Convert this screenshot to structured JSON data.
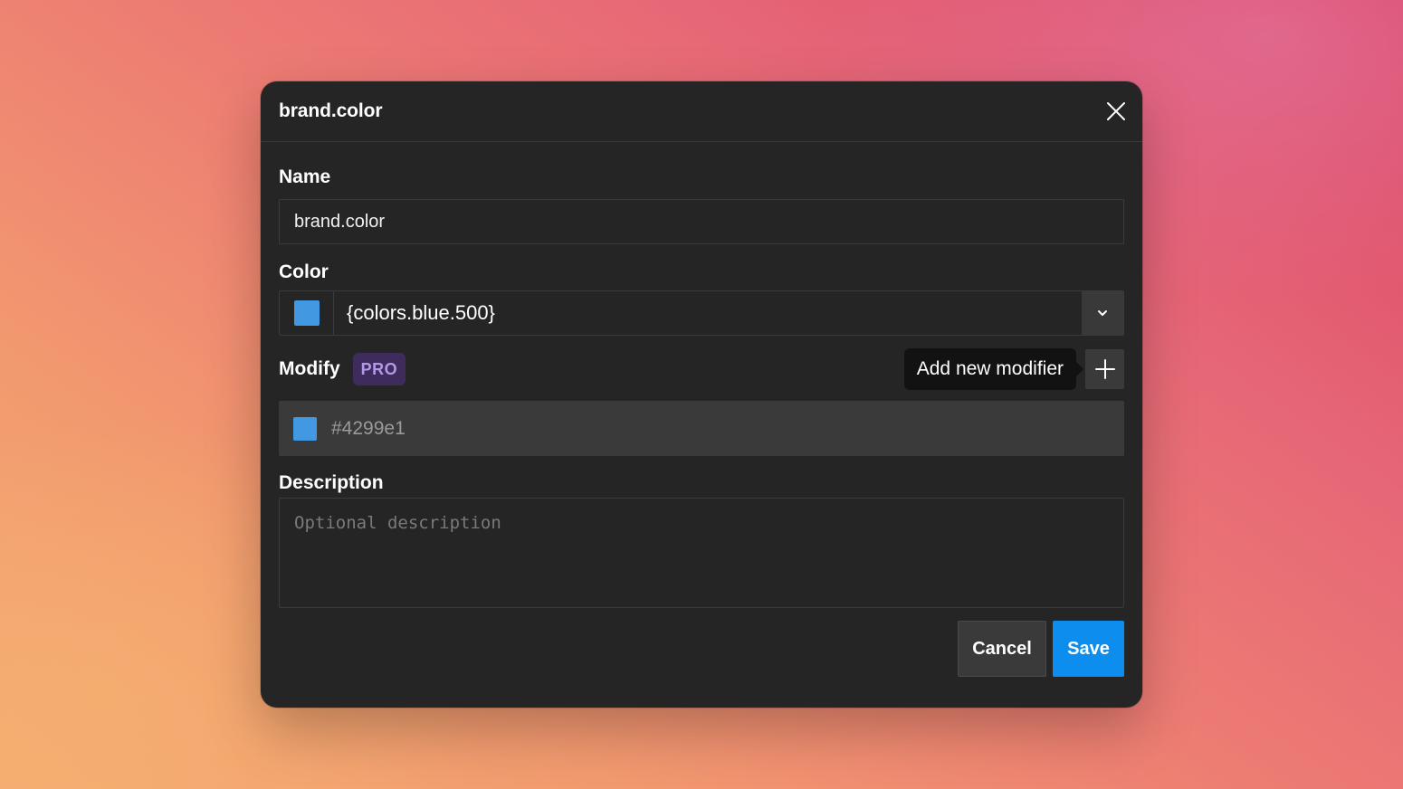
{
  "dialog": {
    "title": "brand.color"
  },
  "fields": {
    "name": {
      "label": "Name",
      "value": "brand.color"
    },
    "color": {
      "label": "Color",
      "value": "{colors.blue.500}",
      "swatch_color": "#4299e1"
    },
    "modify": {
      "label": "Modify",
      "badge": "PRO",
      "tooltip": "Add new modifier",
      "modifier_value": "#4299e1",
      "modifier_swatch_color": "#4299e1"
    },
    "description": {
      "label": "Description",
      "placeholder": "Optional description"
    }
  },
  "buttons": {
    "cancel": "Cancel",
    "save": "Save"
  },
  "icons": {
    "close": "close-icon",
    "dropdown": "chevron-down-icon",
    "add": "plus-icon"
  },
  "colors": {
    "dialog_bg": "#252525",
    "accent": "#0d8ded",
    "pro_badge_bg": "#3e2d5c",
    "pro_badge_text": "#b399e6"
  }
}
